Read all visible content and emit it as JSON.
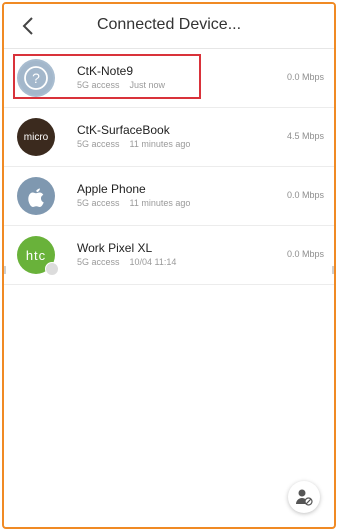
{
  "header": {
    "title": "Connected Device..."
  },
  "devices": [
    {
      "name": "CtK-Note9",
      "access": "5G access",
      "time": "Just now",
      "speed": "0.0 Mbps",
      "icon": "question-icon"
    },
    {
      "name": "CtK-SurfaceBook",
      "access": "5G access",
      "time": "11 minutes ago",
      "speed": "4.5 Mbps",
      "icon": "microsoft-logo",
      "logo_text": "micro"
    },
    {
      "name": "Apple Phone",
      "access": "5G access",
      "time": "11 minutes ago",
      "speed": "0.0 Mbps",
      "icon": "apple-logo"
    },
    {
      "name": "Work Pixel XL",
      "access": "5G access",
      "time": "10/04 11:14",
      "speed": "0.0 Mbps",
      "icon": "htc-logo",
      "logo_text": "htc"
    }
  ],
  "colors": {
    "accent_border": "#f08a24",
    "highlight_box": "#d9323a"
  }
}
